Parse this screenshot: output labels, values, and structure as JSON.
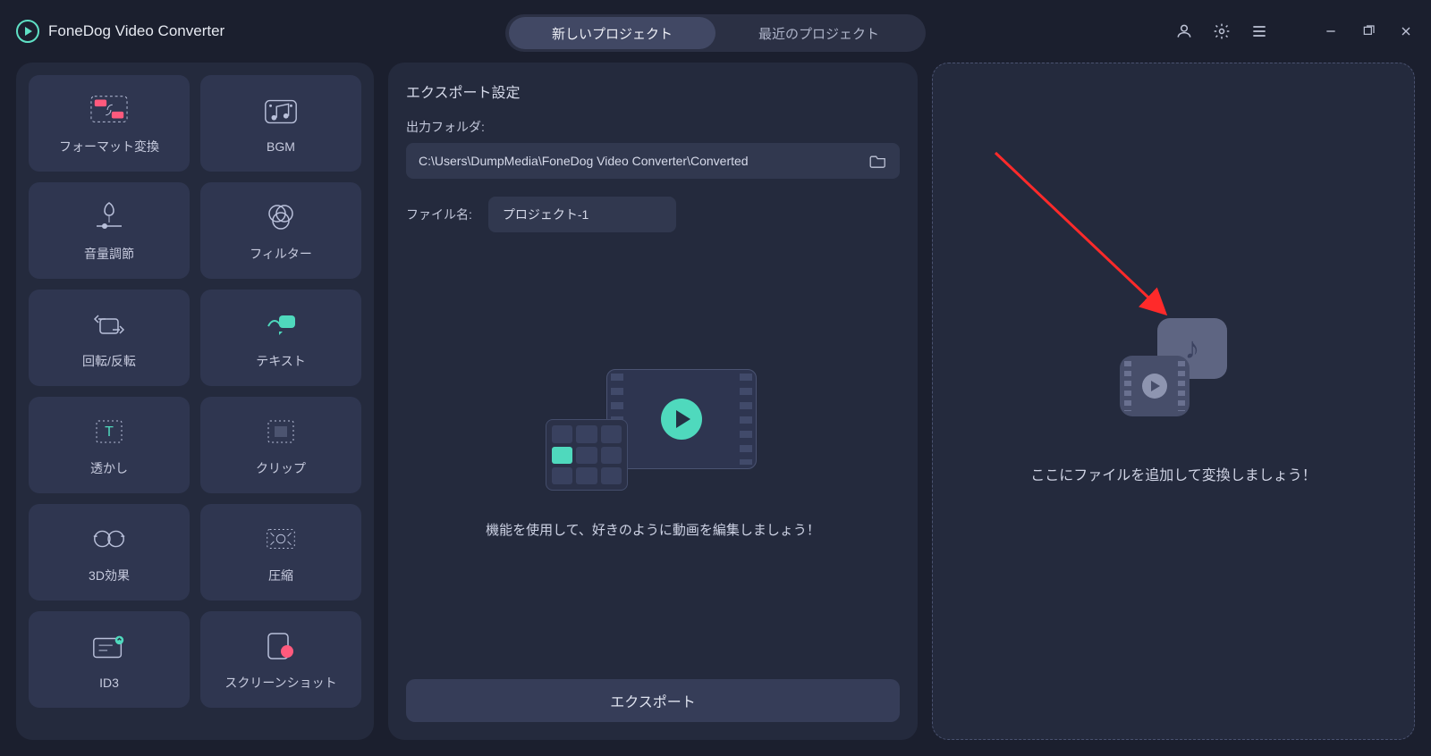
{
  "app": {
    "title": "FoneDog Video Converter"
  },
  "header": {
    "tabs": [
      {
        "label": "新しいプロジェクト",
        "active": true
      },
      {
        "label": "最近のプロジェクト",
        "active": false
      }
    ]
  },
  "sidebar": {
    "tools": [
      {
        "key": "format-convert",
        "label": "フォーマット変換"
      },
      {
        "key": "bgm",
        "label": "BGM"
      },
      {
        "key": "volume",
        "label": "音量調節"
      },
      {
        "key": "filter",
        "label": "フィルター"
      },
      {
        "key": "rotate-flip",
        "label": "回転/反転"
      },
      {
        "key": "text",
        "label": "テキスト"
      },
      {
        "key": "watermark",
        "label": "透かし"
      },
      {
        "key": "clip",
        "label": "クリップ"
      },
      {
        "key": "3d-effect",
        "label": "3D効果"
      },
      {
        "key": "compress",
        "label": "圧縮"
      },
      {
        "key": "id3",
        "label": "ID3"
      },
      {
        "key": "screenshot",
        "label": "スクリーンショット"
      }
    ]
  },
  "export": {
    "section_title": "エクスポート設定",
    "output_folder_label": "出力フォルダ:",
    "output_folder_path": "C:\\Users\\DumpMedia\\FoneDog Video Converter\\Converted",
    "filename_label": "ファイル名:",
    "filename_value": "プロジェクト-1",
    "hint": "機能を使用して、好きのように動画を編集しましょう！",
    "export_button": "エクスポート"
  },
  "drop": {
    "hint": "ここにファイルを追加して変換しましょう！"
  },
  "icons": {
    "account": "account-icon",
    "settings": "gear-icon",
    "menu": "menu-icon",
    "minimize": "minimize-icon",
    "maximize": "maximize-icon",
    "close": "close-icon",
    "folder": "folder-icon"
  }
}
